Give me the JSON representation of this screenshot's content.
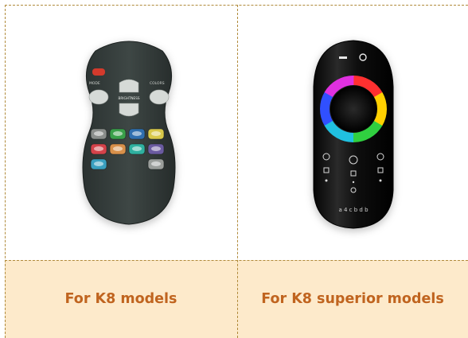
{
  "products": [
    {
      "caption": "For K8 models",
      "image": "classic-ir-remote",
      "remote_labels": {
        "left": "MODE",
        "right": "COLORS",
        "center": "BRIGHTNESS"
      },
      "button_colors": [
        "#6a6a6a",
        "#3aa04a",
        "#2f6fb0",
        "#d8c84a",
        "#d4424a",
        "#d8904a",
        "#2fb0a0",
        "#8a5ab0",
        "#3aa0c0",
        "#9a9a9a"
      ]
    },
    {
      "caption": "For K8 superior models",
      "image": "touch-rgb-remote",
      "bottom_text": "a 4 c b d b"
    }
  ],
  "colors": {
    "caption": "#c0641f",
    "caption_bg": "#fdeacb",
    "border": "#b08a3a"
  }
}
